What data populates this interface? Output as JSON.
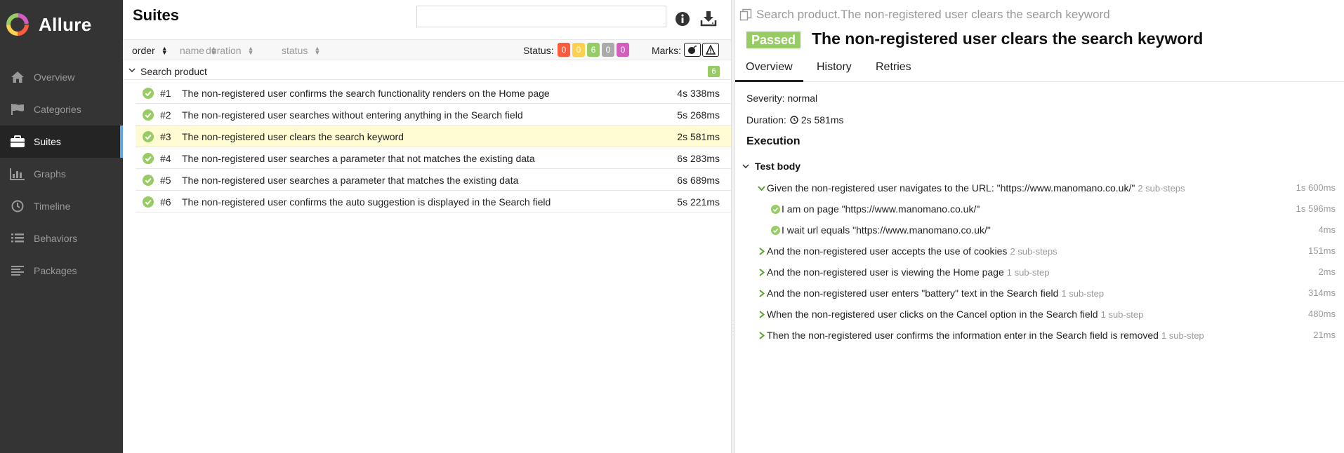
{
  "app": {
    "name": "Allure"
  },
  "sidebar": {
    "items": [
      {
        "label": "Overview",
        "icon": "home-icon"
      },
      {
        "label": "Categories",
        "icon": "flag-icon"
      },
      {
        "label": "Suites",
        "icon": "briefcase-icon",
        "active": true
      },
      {
        "label": "Graphs",
        "icon": "bar-chart-icon"
      },
      {
        "label": "Timeline",
        "icon": "clock-icon"
      },
      {
        "label": "Behaviors",
        "icon": "list-icon"
      },
      {
        "label": "Packages",
        "icon": "align-left-icon"
      }
    ]
  },
  "suites": {
    "title": "Suites",
    "search_placeholder": "",
    "sort": {
      "order": "order",
      "name": "name",
      "duration": "duration",
      "status": "status"
    },
    "status_label": "Status:",
    "status_counts": [
      {
        "value": "0",
        "color": "#fd5a3e"
      },
      {
        "value": "0",
        "color": "#ffd050"
      },
      {
        "value": "6",
        "color": "#97cc64"
      },
      {
        "value": "0",
        "color": "#aaaaaa"
      },
      {
        "value": "0",
        "color": "#d35ebe"
      }
    ],
    "marks_label": "Marks:",
    "group": {
      "name": "Search product",
      "count": "6"
    },
    "tests": [
      {
        "num": "#1",
        "name": "The non-registered user confirms the search functionality renders on the Home page",
        "duration": "4s 338ms"
      },
      {
        "num": "#2",
        "name": "The non-registered user searches without entering anything in the Search field",
        "duration": "5s 268ms"
      },
      {
        "num": "#3",
        "name": "The non-registered user clears the search keyword",
        "duration": "2s 581ms",
        "selected": true
      },
      {
        "num": "#4",
        "name": "The non-registered user searches a parameter that not matches the existing data",
        "duration": "6s 283ms"
      },
      {
        "num": "#5",
        "name": "The non-registered user searches a parameter that matches the existing data",
        "duration": "6s 689ms"
      },
      {
        "num": "#6",
        "name": "The non-registered user confirms the auto suggestion is displayed in the Search field",
        "duration": "5s 221ms"
      }
    ]
  },
  "detail": {
    "path": "Search product.The non-registered user clears the search keyword",
    "status": "Passed",
    "title": "The non-registered user clears the search keyword",
    "tabs": [
      "Overview",
      "History",
      "Retries"
    ],
    "severity": "Severity: normal",
    "duration_label": "Duration:",
    "duration_value": "2s 581ms",
    "execution_title": "Execution",
    "test_body_label": "Test body",
    "steps": [
      {
        "text": "Given the non-registered user navigates to the URL: \"https://www.manomano.co.uk/\"",
        "sub": "2 sub-steps",
        "duration": "1s 600ms",
        "expanded": true
      },
      {
        "text": "I am on page \"https://www.manomano.co.uk/\"",
        "sub": "",
        "duration": "1s 596ms",
        "child": true
      },
      {
        "text": "I wait url equals \"https://www.manomano.co.uk/\"",
        "sub": "",
        "duration": "4ms",
        "child": true
      },
      {
        "text": "And the non-registered user accepts the use of cookies",
        "sub": "2 sub-steps",
        "duration": "151ms"
      },
      {
        "text": "And the non-registered user is viewing the Home page",
        "sub": "1 sub-step",
        "duration": "2ms"
      },
      {
        "text": "And the non-registered user enters \"battery\" text in the Search field",
        "sub": "1 sub-step",
        "duration": "314ms"
      },
      {
        "text": "When the non-registered user clicks on the Cancel option in the Search field",
        "sub": "1 sub-step",
        "duration": "480ms"
      },
      {
        "text": "Then the non-registered user confirms the information enter in the Search field is removed",
        "sub": "1 sub-step",
        "duration": "21ms"
      }
    ]
  }
}
